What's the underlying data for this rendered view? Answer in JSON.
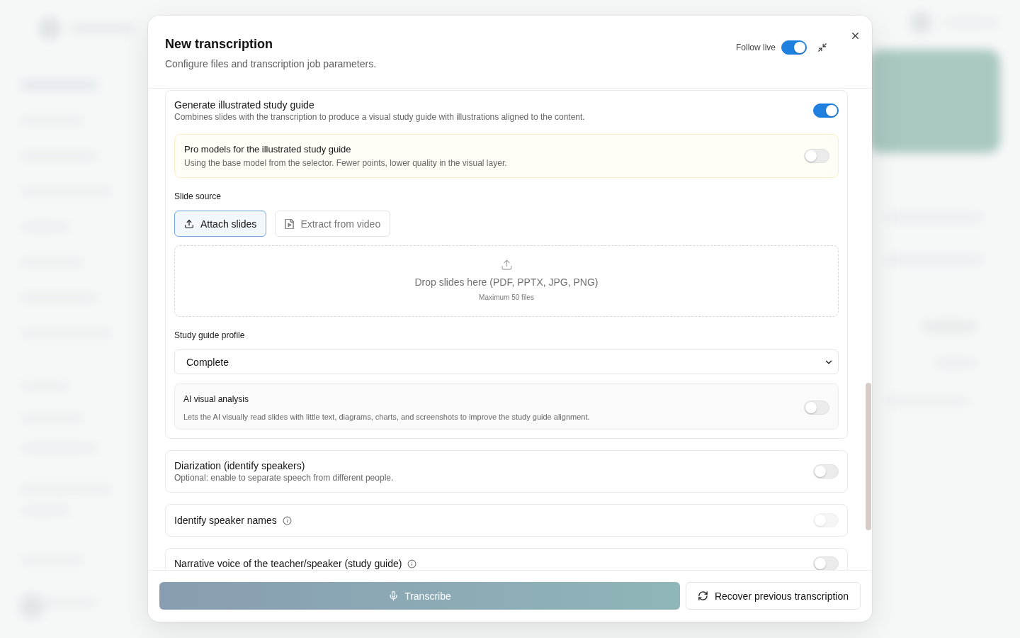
{
  "dialog": {
    "title": "New transcription",
    "subtitle": "Configure files and transcription job parameters.",
    "follow_live": {
      "label": "Follow live",
      "on": true
    }
  },
  "study_guide": {
    "title": "Generate illustrated study guide",
    "description": "Combines slides with the transcription to produce a visual study guide with illustrations aligned to the content.",
    "on": true,
    "pro_models": {
      "title": "Pro models for the illustrated study guide",
      "description": "Using the base model from the selector. Fewer points, lower quality in the visual layer.",
      "on": false
    },
    "slide_source": {
      "label": "Slide source",
      "options": [
        {
          "label": "Attach slides",
          "kind": "upload",
          "selected": true
        },
        {
          "label": "Extract from video",
          "kind": "video",
          "selected": false
        }
      ]
    },
    "dropzone": {
      "text": "Drop slides here (PDF, PPTX, JPG, PNG)",
      "note": "Maximum 50 files"
    },
    "profile": {
      "label": "Study guide profile",
      "value": "Complete"
    },
    "ai_visual_analysis": {
      "title": "AI visual analysis",
      "description": "Lets the AI visually read slides with little text, diagrams, charts, and screenshots to improve the study guide alignment.",
      "on": false
    }
  },
  "options": [
    {
      "title": "Diarization (identify speakers)",
      "description": "Optional: enable to separate speech from different people.",
      "info": false,
      "on": false,
      "disabled": false
    },
    {
      "title": "Identify speaker names",
      "info": true,
      "on": false,
      "disabled": true
    },
    {
      "title": "Narrative voice of the teacher/speaker (study guide)",
      "info": true,
      "on": false,
      "disabled": false
    }
  ],
  "footer": {
    "primary": {
      "label": "Transcribe",
      "disabled": true
    },
    "secondary": {
      "label": "Recover previous transcription"
    }
  }
}
